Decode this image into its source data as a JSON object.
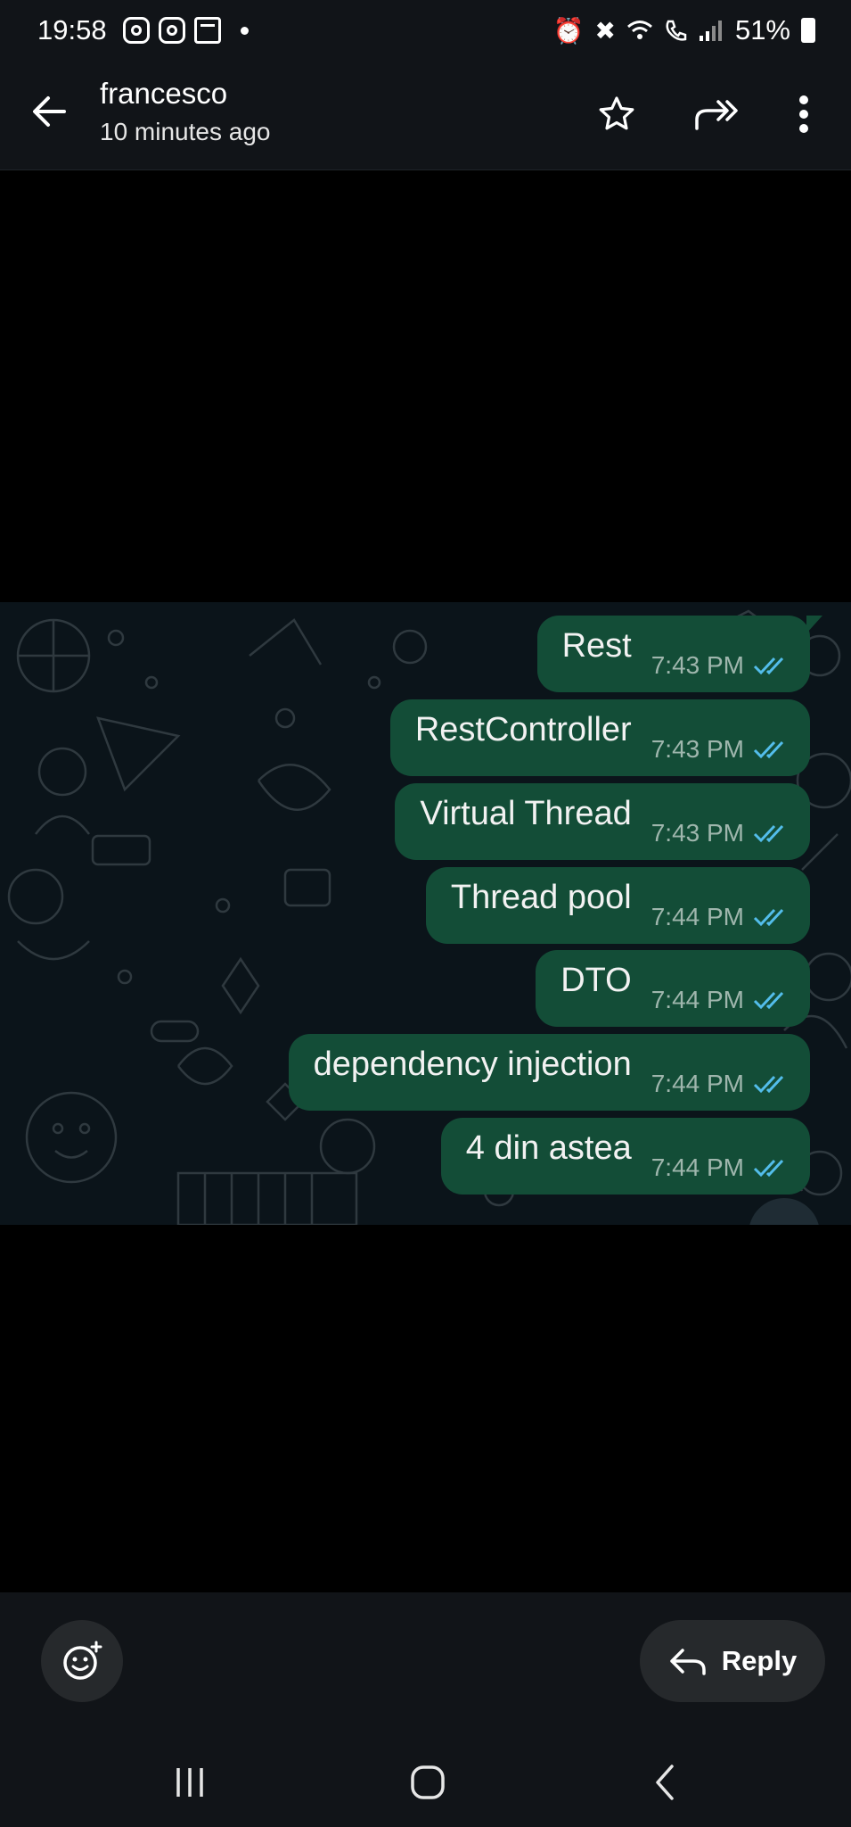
{
  "status_bar": {
    "time": "19:58",
    "battery": "51%",
    "left_icons": [
      "instagram-icon",
      "instagram-icon",
      "calendar-icon"
    ],
    "right_icons": [
      "alarm-icon",
      "mute-icon",
      "wifi-icon",
      "wifi-calling-icon",
      "signal-icon",
      "battery-icon"
    ]
  },
  "header": {
    "contact_name": "francesco",
    "subtitle": "10 minutes ago",
    "actions": [
      "star-icon",
      "forward-icon",
      "more-icon"
    ]
  },
  "messages": [
    {
      "text": "Rest",
      "time": "7:43 PM",
      "status": "read"
    },
    {
      "text": "RestController",
      "time": "7:43 PM",
      "status": "read"
    },
    {
      "text": "Virtual Thread",
      "time": "7:43 PM",
      "status": "read"
    },
    {
      "text": "Thread pool",
      "time": "7:44 PM",
      "status": "read"
    },
    {
      "text": "DTO",
      "time": "7:44 PM",
      "status": "read"
    },
    {
      "text": "dependency  injection",
      "time": "7:44 PM",
      "status": "read"
    },
    {
      "text": "4 din astea",
      "time": "7:44 PM",
      "status": "read"
    }
  ],
  "footer": {
    "reply_label": "Reply"
  },
  "colors": {
    "bar_background": "#111418",
    "bubble": "#134d37",
    "chat_background": "#0b141a",
    "read_tick": "#53bdeb"
  }
}
